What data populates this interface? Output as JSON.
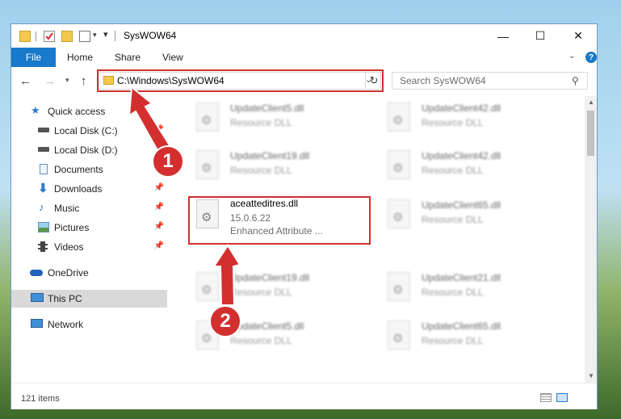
{
  "window": {
    "title": "SysWOW64",
    "controls": {
      "minimize": "—",
      "maximize": "☐",
      "close": "✕"
    }
  },
  "ribbon": {
    "tabs": [
      {
        "label": "File"
      },
      {
        "label": "Home"
      },
      {
        "label": "Share"
      },
      {
        "label": "View"
      }
    ],
    "help_label": "?"
  },
  "address_bar": {
    "path": "C:\\Windows\\SysWOW64",
    "search_placeholder": "Search SysWOW64"
  },
  "navigation": {
    "items": [
      {
        "label": "Quick access",
        "icon": "star-icon"
      },
      {
        "label": "Local Disk (C:)",
        "icon": "drive-icon",
        "pinned": true
      },
      {
        "label": "Local Disk (D:)",
        "icon": "drive-icon",
        "pinned": true
      },
      {
        "label": "Documents",
        "icon": "documents-icon",
        "pinned": true
      },
      {
        "label": "Downloads",
        "icon": "download-icon",
        "pinned": true
      },
      {
        "label": "Music",
        "icon": "music-icon",
        "pinned": true
      },
      {
        "label": "Pictures",
        "icon": "pictures-icon",
        "pinned": true
      },
      {
        "label": "Videos",
        "icon": "videos-icon",
        "pinned": true
      },
      {
        "label": "OneDrive",
        "icon": "cloud-icon"
      },
      {
        "label": "This PC",
        "icon": "computer-icon",
        "selected": true
      },
      {
        "label": "Network",
        "icon": "network-icon"
      }
    ]
  },
  "files": {
    "left_column": [
      {
        "name": "UpdateClient5.dll",
        "type": "Resource DLL"
      },
      {
        "name": "UpdateClient19.dll",
        "type": "Resource DLL"
      },
      {
        "name": "aceatteditres.dll",
        "version": "15.0.6.22",
        "description": "Enhanced Attribute ...",
        "highlighted": true
      },
      {
        "name": "UpdateClient19.dll",
        "type": "Resource DLL"
      },
      {
        "name": "UpdateClient5.dll",
        "type": "Resource DLL"
      }
    ],
    "right_column": [
      {
        "name": "UpdateClient42.dll",
        "type": "Resource DLL"
      },
      {
        "name": "UpdateClient42.dll",
        "type": "Resource DLL"
      },
      {
        "name": "UpdateClient65.dll",
        "type": "Resource DLL"
      },
      {
        "name": "UpdateClient21.dll",
        "type": "Resource DLL"
      },
      {
        "name": "UpdateClient65.dll",
        "type": "Resource DLL"
      }
    ]
  },
  "status_bar": {
    "item_count": "121 items"
  },
  "annotations": {
    "callout_1": "1",
    "callout_2": "2",
    "accent_color": "#d32f2f"
  }
}
